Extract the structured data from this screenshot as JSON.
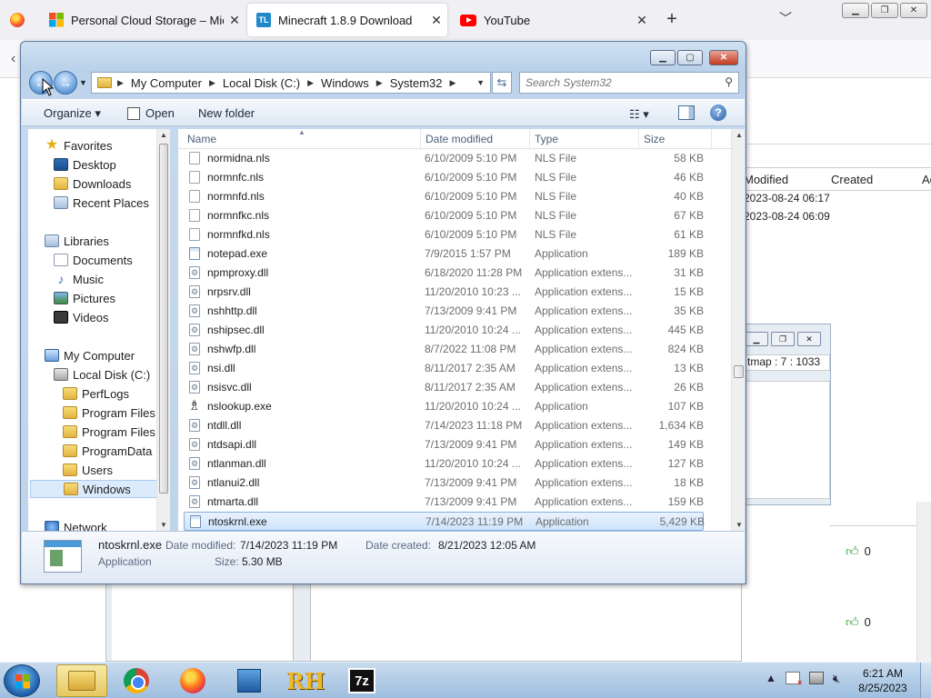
{
  "browser": {
    "tabs": [
      {
        "label": "Personal Cloud Storage – Micro",
        "favicon": "microsoft-icon"
      },
      {
        "label": "Minecraft 1.8.9 Download",
        "favicon": "tl-icon",
        "favicon_text": "TL",
        "active": true
      },
      {
        "label": "YouTube",
        "favicon": "youtube-icon"
      }
    ],
    "new_tab_symbol": "+",
    "tab_list_symbol": "﹀",
    "close_symbol": "✕"
  },
  "background_page": {
    "table_headers": [
      "Modified",
      "Created",
      "Ac"
    ],
    "rows": [
      "2023-08-24 06:17",
      "2023-08-24 06:09"
    ],
    "window_text": "tmap : 7 : 1033",
    "likes": [
      "0",
      "0"
    ]
  },
  "dialog": {
    "address": {
      "crumbs": [
        "My Computer",
        "Local Disk (C:)",
        "Windows",
        "System32"
      ]
    },
    "search": {
      "placeholder": "Search System32"
    },
    "commands": {
      "organize": "Organize ▾",
      "open": "Open",
      "new_folder": "New folder",
      "help": "?"
    },
    "nav": {
      "favorites": "Favorites",
      "desktop": "Desktop",
      "downloads": "Downloads",
      "recent_places": "Recent Places",
      "libraries": "Libraries",
      "documents": "Documents",
      "music": "Music",
      "pictures": "Pictures",
      "videos": "Videos",
      "my_computer": "My Computer",
      "local_disk": "Local Disk (C:)",
      "perflogs": "PerfLogs",
      "program_files": "Program Files",
      "program_files_x86": "Program Files (",
      "programdata": "ProgramData",
      "users": "Users",
      "windows": "Windows",
      "network": "Network"
    },
    "columns": {
      "name": "Name",
      "date": "Date modified",
      "type": "Type",
      "size": "Size"
    },
    "files": [
      {
        "name": "normidna.nls",
        "date": "6/10/2009 5:10 PM",
        "type": "NLS File",
        "size": "58 KB",
        "icon": "file"
      },
      {
        "name": "normnfc.nls",
        "date": "6/10/2009 5:10 PM",
        "type": "NLS File",
        "size": "46 KB",
        "icon": "file"
      },
      {
        "name": "normnfd.nls",
        "date": "6/10/2009 5:10 PM",
        "type": "NLS File",
        "size": "40 KB",
        "icon": "file"
      },
      {
        "name": "normnfkc.nls",
        "date": "6/10/2009 5:10 PM",
        "type": "NLS File",
        "size": "67 KB",
        "icon": "file"
      },
      {
        "name": "normnfkd.nls",
        "date": "6/10/2009 5:10 PM",
        "type": "NLS File",
        "size": "61 KB",
        "icon": "file"
      },
      {
        "name": "notepad.exe",
        "date": "7/9/2015 1:57 PM",
        "type": "Application",
        "size": "189 KB",
        "icon": "app"
      },
      {
        "name": "npmproxy.dll",
        "date": "6/18/2020 11:28 PM",
        "type": "Application extens...",
        "size": "31 KB",
        "icon": "dll"
      },
      {
        "name": "nrpsrv.dll",
        "date": "11/20/2010 10:23 ...",
        "type": "Application extens...",
        "size": "15 KB",
        "icon": "dll"
      },
      {
        "name": "nshhttp.dll",
        "date": "7/13/2009 9:41 PM",
        "type": "Application extens...",
        "size": "35 KB",
        "icon": "dll"
      },
      {
        "name": "nshipsec.dll",
        "date": "11/20/2010 10:24 ...",
        "type": "Application extens...",
        "size": "445 KB",
        "icon": "dll"
      },
      {
        "name": "nshwfp.dll",
        "date": "8/7/2022 11:08 PM",
        "type": "Application extens...",
        "size": "824 KB",
        "icon": "dll"
      },
      {
        "name": "nsi.dll",
        "date": "8/11/2017 2:35 AM",
        "type": "Application extens...",
        "size": "13 KB",
        "icon": "dll"
      },
      {
        "name": "nsisvc.dll",
        "date": "8/11/2017 2:35 AM",
        "type": "Application extens...",
        "size": "26 KB",
        "icon": "dll"
      },
      {
        "name": "nslookup.exe",
        "date": "11/20/2010 10:24 ...",
        "type": "Application",
        "size": "107 KB",
        "icon": "ns"
      },
      {
        "name": "ntdll.dll",
        "date": "7/14/2023 11:18 PM",
        "type": "Application extens...",
        "size": "1,634 KB",
        "icon": "dll"
      },
      {
        "name": "ntdsapi.dll",
        "date": "7/13/2009 9:41 PM",
        "type": "Application extens...",
        "size": "149 KB",
        "icon": "dll"
      },
      {
        "name": "ntlanman.dll",
        "date": "11/20/2010 10:24 ...",
        "type": "Application extens...",
        "size": "127 KB",
        "icon": "dll"
      },
      {
        "name": "ntlanui2.dll",
        "date": "7/13/2009 9:41 PM",
        "type": "Application extens...",
        "size": "18 KB",
        "icon": "dll"
      },
      {
        "name": "ntmarta.dll",
        "date": "7/13/2009 9:41 PM",
        "type": "Application extens...",
        "size": "159 KB",
        "icon": "dll"
      },
      {
        "name": "ntoskrnl.exe",
        "date": "7/14/2023 11:19 PM",
        "type": "Application",
        "size": "5,429 KB",
        "icon": "app",
        "selected": true
      }
    ],
    "details": {
      "name": "ntoskrnl.exe",
      "type": "Application",
      "date_modified_label": "Date modified:",
      "date_modified": "7/14/2023 11:19 PM",
      "date_created_label": "Date created:",
      "date_created": "8/21/2023 12:05 AM",
      "size_label": "Size:",
      "size": "5.30 MB"
    }
  },
  "taskbar": {
    "apps": [
      "windows-explorer",
      "chrome",
      "firefox",
      "remote-desktop",
      "rh",
      "7-zip"
    ],
    "rh_label": "RH",
    "sevenzip_label": "7z",
    "clock_time": "6:21 AM",
    "clock_date": "8/25/2023"
  }
}
